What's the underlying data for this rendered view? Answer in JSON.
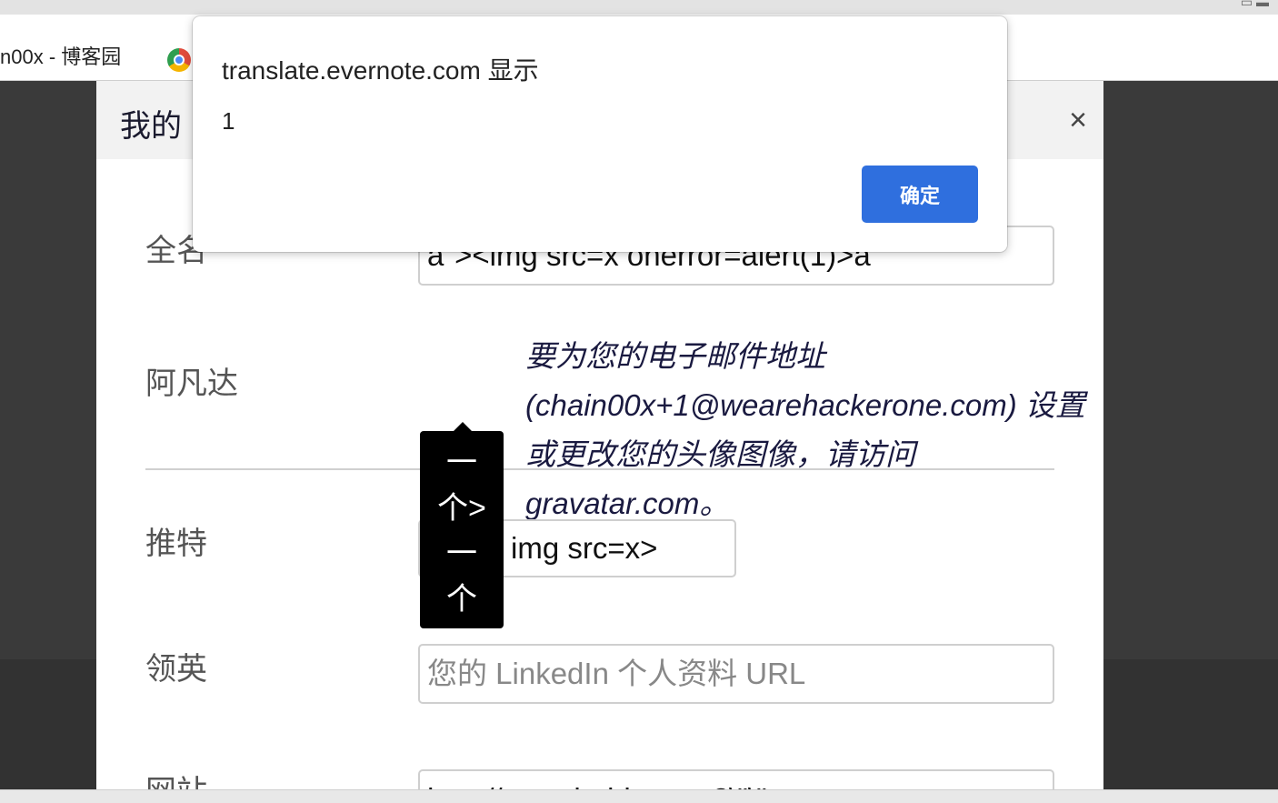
{
  "browser": {
    "bookmark_label": "n00x - 博客园",
    "bookmark_icon": "browser-favicon"
  },
  "modal": {
    "title": "我的",
    "close_symbol": "×",
    "fields": {
      "fullname": {
        "label": "全名",
        "value": "a\"><img src=x onerror=alert(1)>a"
      },
      "avatar": {
        "label": "阿凡达",
        "note": "要为您的电子邮件地址 (chain00x+1@wearehackerone.com) 设置或更改您的头像图像，请访问 gravatar.com。"
      },
      "twitter": {
        "label": "推特",
        "value": "img src=x>"
      },
      "linkedin": {
        "label": "领英",
        "placeholder": "您的 LinkedIn 个人资料 URL"
      },
      "website": {
        "label": "网站",
        "value": "http://www.baidu.com?\\\"\\\""
      }
    }
  },
  "tooltip": {
    "text": "一\n个>\n一\n个"
  },
  "alert": {
    "title": "translate.evernote.com 显示",
    "message": "1",
    "ok_label": "确定",
    "ok_color": "#2f6fde"
  }
}
